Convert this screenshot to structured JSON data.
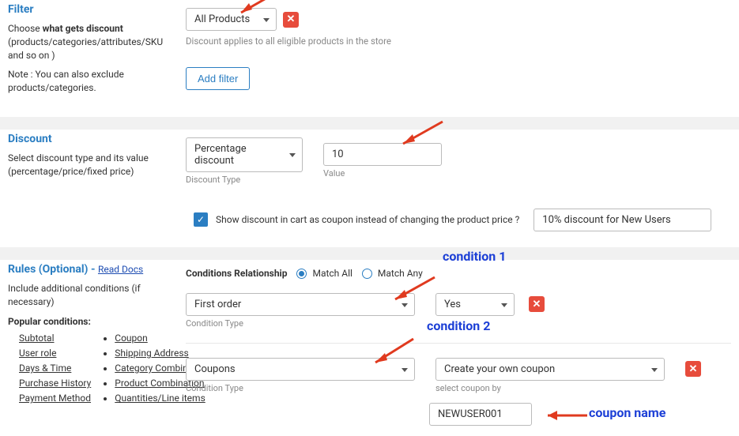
{
  "filter": {
    "title": "Filter",
    "help1a": "Choose ",
    "help1b": "what gets discount",
    "help1c": " (products/categories/attributes/SKU and so on )",
    "help2": "Note : You can also exclude products/categories.",
    "select_value": "All Products",
    "applies_note": "Discount applies to all eligible products in the store",
    "add_filter": "Add filter"
  },
  "discount": {
    "title": "Discount",
    "help": "Select discount type and its value (percentage/price/fixed price)",
    "type_value": "Percentage discount",
    "type_label": "Discount Type",
    "value": "10",
    "value_label": "Value",
    "show_in_cart": "Show discount in cart as coupon instead of changing the product price ?",
    "coupon_text": "10% discount for New Users"
  },
  "rules": {
    "title": "Rules (Optional) - ",
    "read_docs": "Read Docs",
    "help": "Include additional conditions (if necessary)",
    "popular_label": "Popular conditions:",
    "popular_col1": [
      "Subtotal",
      "User role",
      "Days & Time",
      "Purchase History",
      "Payment Method"
    ],
    "popular_col2": [
      "Coupon",
      "Shipping Address",
      "Category Combination",
      "Product Combination",
      "Quantities/Line items"
    ],
    "cond_rel_label": "Conditions Relationship",
    "match_all": "Match All",
    "match_any": "Match Any",
    "cond1": {
      "type": "First order",
      "yes": "Yes",
      "type_label": "Condition Type"
    },
    "cond2": {
      "type": "Coupons",
      "coupon_mode": "Create your own coupon",
      "type_label": "Condition Type",
      "select_by_label": "select coupon by",
      "coupon_value": "NEWUSER001"
    }
  },
  "annotations": {
    "c1": "condition 1",
    "c2": "condition 2",
    "cn": "coupon name"
  }
}
